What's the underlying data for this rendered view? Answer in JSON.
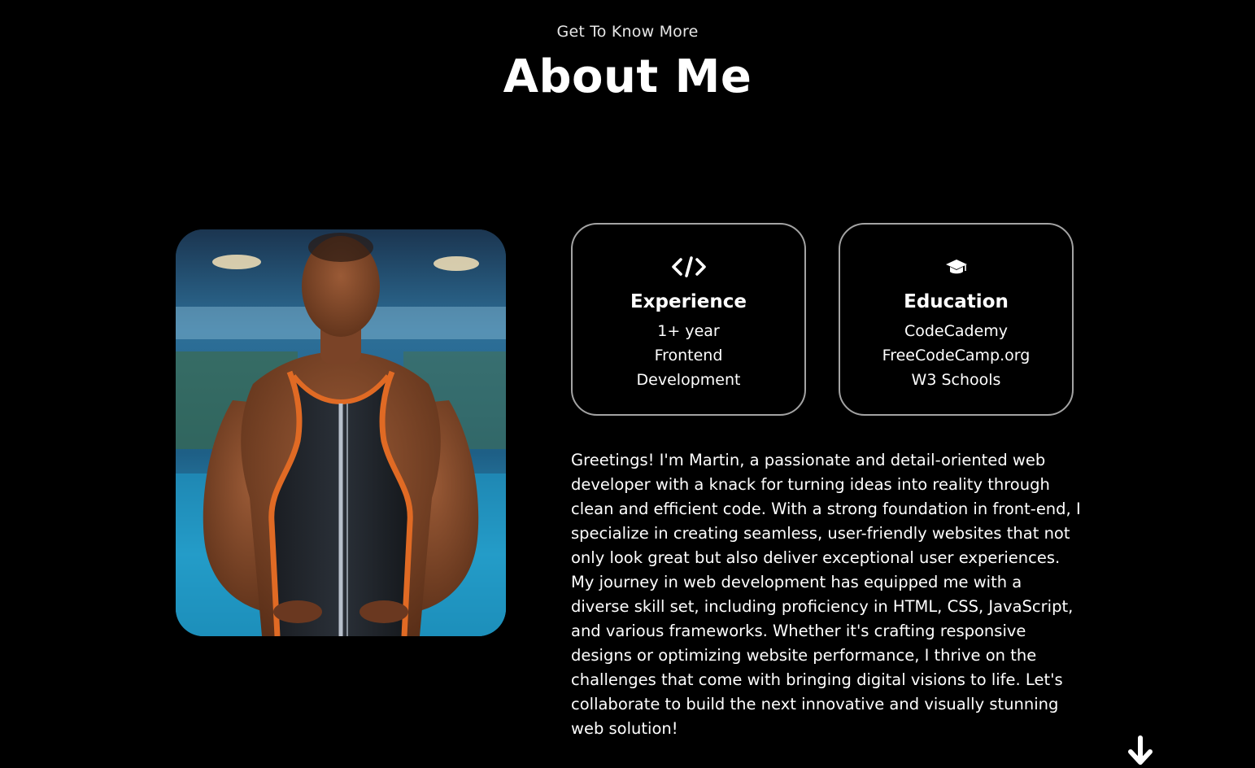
{
  "header": {
    "eyebrow": "Get To Know More",
    "title": "About Me"
  },
  "profile_photo": {
    "alt": "Profile picture"
  },
  "cards": {
    "experience": {
      "icon": "code-icon",
      "title": "Experience",
      "lines": [
        "1+ year",
        "Frontend",
        "Development"
      ]
    },
    "education": {
      "icon": "graduation-cap-icon",
      "title": "Education",
      "lines": [
        "CodeCademy",
        "FreeCodeCamp.org",
        "W3 Schools"
      ]
    }
  },
  "bio": {
    "text": "Greetings! I'm Martin, a passionate and detail-oriented web developer with a knack for turning ideas into reality through clean and efficient code. With a strong foundation in front-end, I specialize in creating seamless, user-friendly websites that not only look great but also deliver exceptional user experiences. My journey in web development has equipped me with a diverse skill set, including proficiency in HTML, CSS, JavaScript, and various frameworks. Whether it's crafting responsive designs or optimizing website performance, I thrive on the challenges that come with bringing digital visions to life. Let's collaborate to build the next innovative and visually stunning web solution!"
  },
  "scroll": {
    "icon": "arrow-down-icon"
  },
  "colors": {
    "background": "#000000",
    "text": "#ffffff",
    "card_border": "#a3a3a3"
  }
}
